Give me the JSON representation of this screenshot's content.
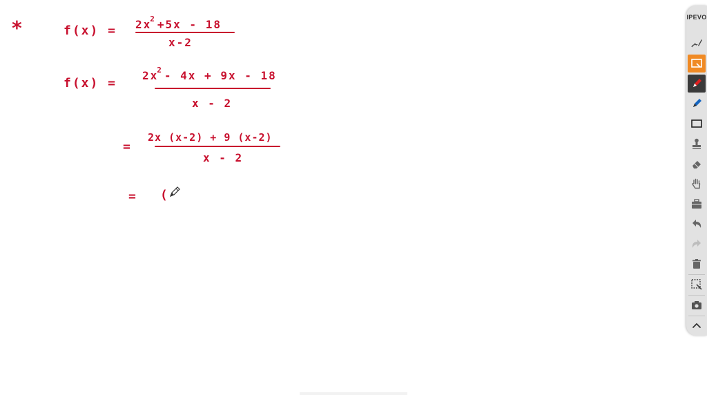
{
  "whiteboard": {
    "bullet": "*",
    "line1": {
      "lhs": "f(x) =",
      "num_a": "2x",
      "num_exp": "2",
      "num_b": "+5x - 18",
      "den": "x-2"
    },
    "line2": {
      "lhs": "f(x) =",
      "num_a": "2x",
      "num_exp": "2",
      "num_b": "- 4x + 9x - 18",
      "den": "x - 2"
    },
    "line3": {
      "eq": "=",
      "num": "2x (x-2) + 9 (x-2)",
      "den": "x - 2"
    },
    "line4": {
      "eq": "=",
      "partial": "("
    }
  },
  "toolbar": {
    "brand": "IPEVO",
    "tools": [
      {
        "name": "signature-tool"
      },
      {
        "name": "screen-capture-tool",
        "active": true
      },
      {
        "name": "red-pen-tool",
        "active": true,
        "color": "#e02020"
      },
      {
        "name": "blue-pen-tool",
        "color": "#1565c0"
      },
      {
        "name": "rectangle-tool"
      },
      {
        "name": "stamp-tool"
      },
      {
        "name": "eraser-tool"
      },
      {
        "name": "hand-tool"
      },
      {
        "name": "toolbox-tool"
      },
      {
        "name": "undo-tool"
      },
      {
        "name": "redo-tool"
      },
      {
        "name": "trash-tool"
      },
      {
        "name": "snapshot-tool"
      },
      {
        "name": "camera-tool"
      },
      {
        "name": "collapse-tool"
      }
    ]
  },
  "colors": {
    "ink": "#c8102e",
    "accent": "#f08a24",
    "toolbar_bg": "#e2e2e2"
  }
}
